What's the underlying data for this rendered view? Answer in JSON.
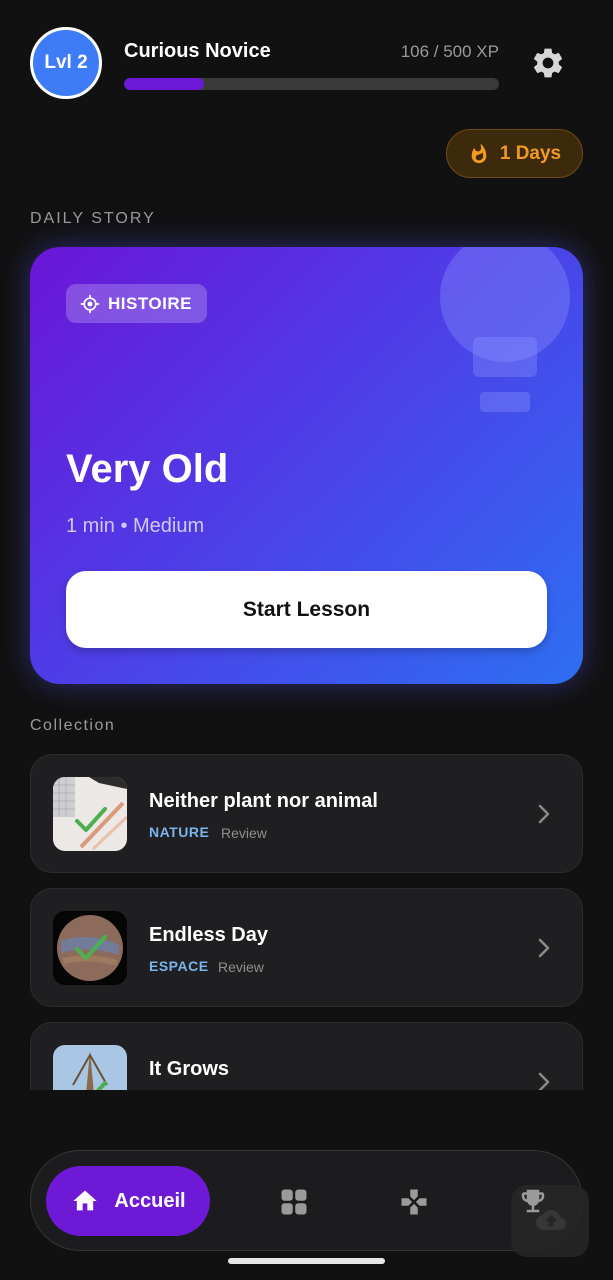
{
  "header": {
    "level_label": "Lvl 2",
    "title": "Curious Novice",
    "xp_text": "106 / 500 XP",
    "xp_progress": 0.212
  },
  "streak": {
    "label": "1 Days"
  },
  "daily_story": {
    "section_label": "DAILY STORY",
    "tag": "HISTOIRE",
    "title": "Very Old",
    "meta": "1 min • Medium",
    "start_label": "Start Lesson"
  },
  "collection": {
    "section_label": "Collection",
    "items": [
      {
        "title": "Neither plant nor animal",
        "category": "NATURE",
        "status": "Review"
      },
      {
        "title": "Endless Day",
        "category": "ESPACE",
        "status": "Review"
      },
      {
        "title": "It Grows",
        "category": "",
        "status": ""
      }
    ]
  },
  "nav": {
    "home_label": "Accueil"
  },
  "colors": {
    "accent": "#6d19d6",
    "streak": "#f39a1e",
    "category": "#7ab4ee",
    "check": "#4caf50"
  }
}
